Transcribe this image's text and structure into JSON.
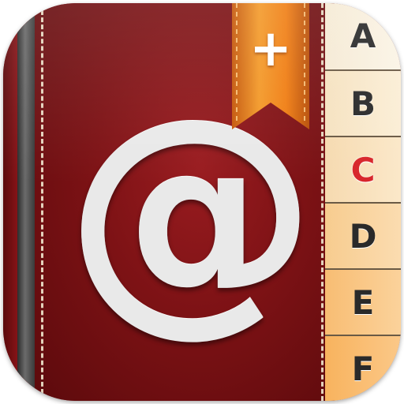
{
  "icon": {
    "symbol": "@",
    "bookmark_symbol": "+",
    "colors": {
      "cover": "#7d1215",
      "ribbon": "#f08a1c",
      "active_tab_letter": "#d8262b",
      "tab_letter": "#2a2a2a"
    }
  },
  "tabs": [
    {
      "label": "A",
      "active": false
    },
    {
      "label": "B",
      "active": false
    },
    {
      "label": "C",
      "active": true
    },
    {
      "label": "D",
      "active": false
    },
    {
      "label": "E",
      "active": false
    },
    {
      "label": "F",
      "active": false
    }
  ]
}
